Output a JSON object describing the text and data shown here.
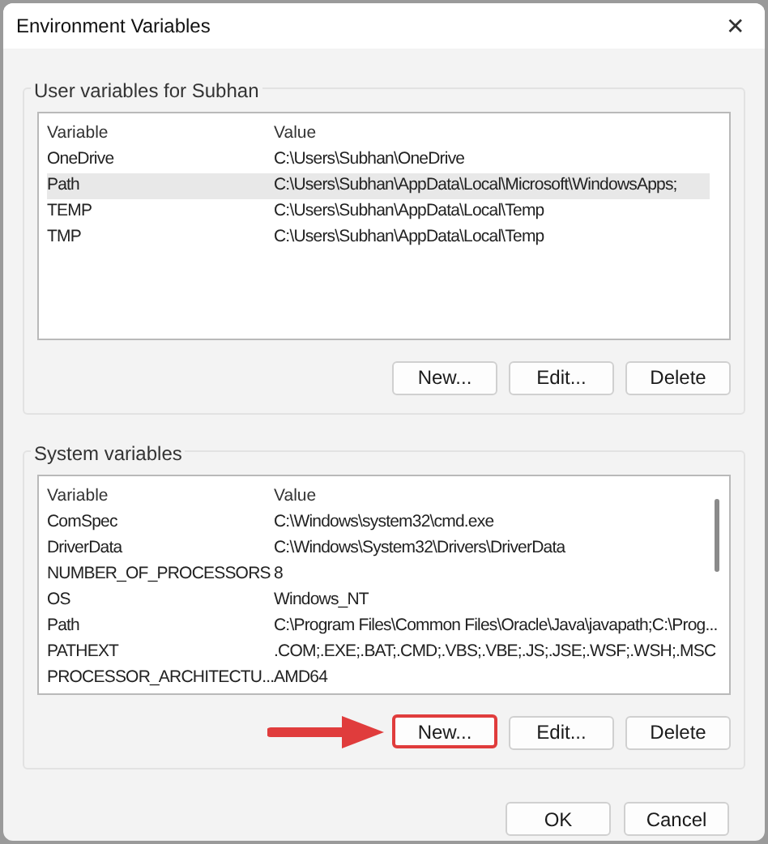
{
  "window": {
    "title": "Environment Variables",
    "close": "✕"
  },
  "user_variables": {
    "label": "User variables for Subhan",
    "columns": [
      "Variable",
      "Value"
    ],
    "rows": [
      {
        "variable": "OneDrive",
        "value": "C:\\Users\\Subhan\\OneDrive",
        "selected": false
      },
      {
        "variable": "Path",
        "value": "C:\\Users\\Subhan\\AppData\\Local\\Microsoft\\WindowsApps;",
        "selected": true
      },
      {
        "variable": "TEMP",
        "value": "C:\\Users\\Subhan\\AppData\\Local\\Temp",
        "selected": false
      },
      {
        "variable": "TMP",
        "value": "C:\\Users\\Subhan\\AppData\\Local\\Temp",
        "selected": false
      }
    ],
    "buttons": [
      {
        "label": "New...",
        "highlighted": false
      },
      {
        "label": "Edit...",
        "highlighted": false
      },
      {
        "label": "Delete",
        "highlighted": false
      }
    ]
  },
  "system_variables": {
    "label": "System variables",
    "columns": [
      "Variable",
      "Value"
    ],
    "rows": [
      {
        "variable": "ComSpec",
        "value": "C:\\Windows\\system32\\cmd.exe",
        "selected": false
      },
      {
        "variable": "DriverData",
        "value": "C:\\Windows\\System32\\Drivers\\DriverData",
        "selected": false
      },
      {
        "variable": "NUMBER_OF_PROCESSORS",
        "value": "8",
        "selected": false
      },
      {
        "variable": "OS",
        "value": "Windows_NT",
        "selected": false
      },
      {
        "variable": "Path",
        "value": "C:\\Program Files\\Common Files\\Oracle\\Java\\javapath;C:\\Prog...",
        "selected": false
      },
      {
        "variable": "PATHEXT",
        "value": ".COM;.EXE;.BAT;.CMD;.VBS;.VBE;.JS;.JSE;.WSF;.WSH;.MSC",
        "selected": false
      },
      {
        "variable": "PROCESSOR_ARCHITECTU...",
        "value": "AMD64",
        "selected": false
      }
    ],
    "buttons": [
      {
        "label": "New...",
        "highlighted": true
      },
      {
        "label": "Edit...",
        "highlighted": false
      },
      {
        "label": "Delete",
        "highlighted": false
      }
    ]
  },
  "footer_buttons": [
    "OK",
    "Cancel"
  ]
}
